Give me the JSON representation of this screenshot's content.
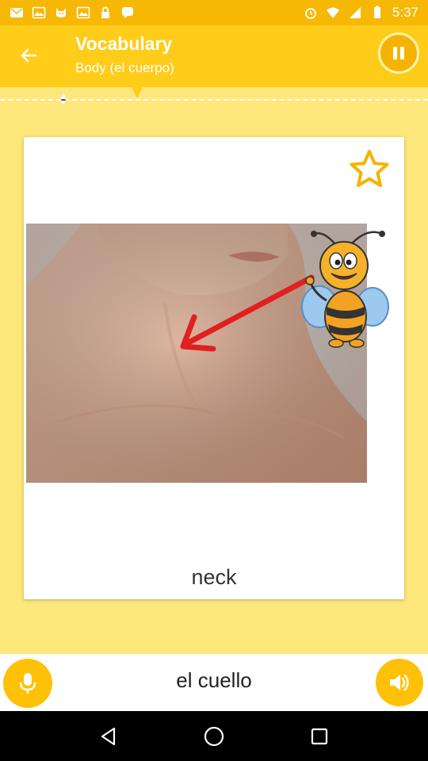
{
  "status_bar": {
    "time": "5:37",
    "left_icons": [
      "mail-icon",
      "image-icon",
      "cat-icon",
      "image-icon",
      "lock-icon",
      "chat-icon"
    ],
    "right_icons": [
      "alarm-icon",
      "wifi-icon",
      "signal-icon",
      "battery-icon"
    ]
  },
  "header": {
    "title": "Vocabulary",
    "subtitle": "Body (el cuerpo)",
    "back_icon": "arrow-back-icon",
    "pause_icon": "pause-icon"
  },
  "card": {
    "word": "neck",
    "star_icon": "star-outline-icon",
    "image": "woman-neck-photo-with-bee-mascot-arrow"
  },
  "footer": {
    "translation": "el cuello",
    "mic_icon": "mic-icon",
    "speaker_icon": "speaker-icon"
  },
  "nav": {
    "icons": [
      "back-triangle-icon",
      "home-circle-icon",
      "recents-square-icon"
    ]
  },
  "colors": {
    "accent": "#ffcc19",
    "status_bar": "#f6b805",
    "background": "#fde77a",
    "button": "#ffc107"
  }
}
